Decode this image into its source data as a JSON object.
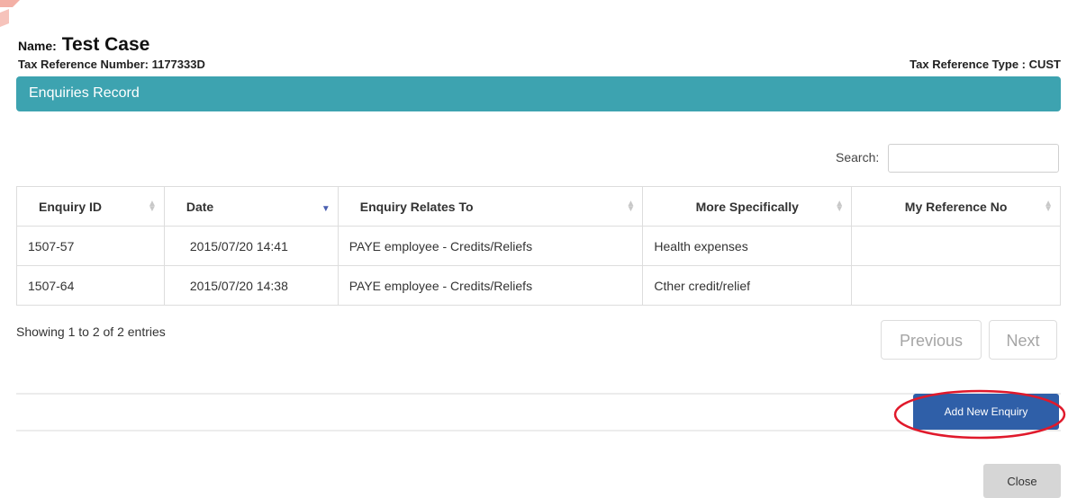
{
  "header": {
    "name_label": "Name:",
    "name_value": "Test Case",
    "tax_reference_number": "Tax Reference Number: 1177333D",
    "tax_reference_type": "Tax Reference Type : CUST"
  },
  "section": {
    "title": "Enquiries Record"
  },
  "search": {
    "label": "Search:",
    "value": ""
  },
  "table": {
    "columns": [
      "Enquiry ID",
      "Date",
      "Enquiry Relates To",
      "More Specifically",
      "My Reference No"
    ],
    "rows": [
      [
        "1507-57",
        "2015/07/20 14:41",
        "PAYE employee - Credits/Reliefs",
        "Health expenses",
        ""
      ],
      [
        "1507-64",
        "2015/07/20 14:38",
        "PAYE employee - Credits/Reliefs",
        "Cther credit/relief",
        ""
      ]
    ]
  },
  "pagination": {
    "info": "Showing 1 to 2 of 2 entries",
    "previous_label": "Previous",
    "next_label": "Next"
  },
  "actions": {
    "add_label": "Add New Enquiry",
    "close_label": "Close"
  },
  "colors": {
    "section_bar": "#3da3b0",
    "add_button": "#2f5fa8",
    "highlight": "#e0192b"
  }
}
